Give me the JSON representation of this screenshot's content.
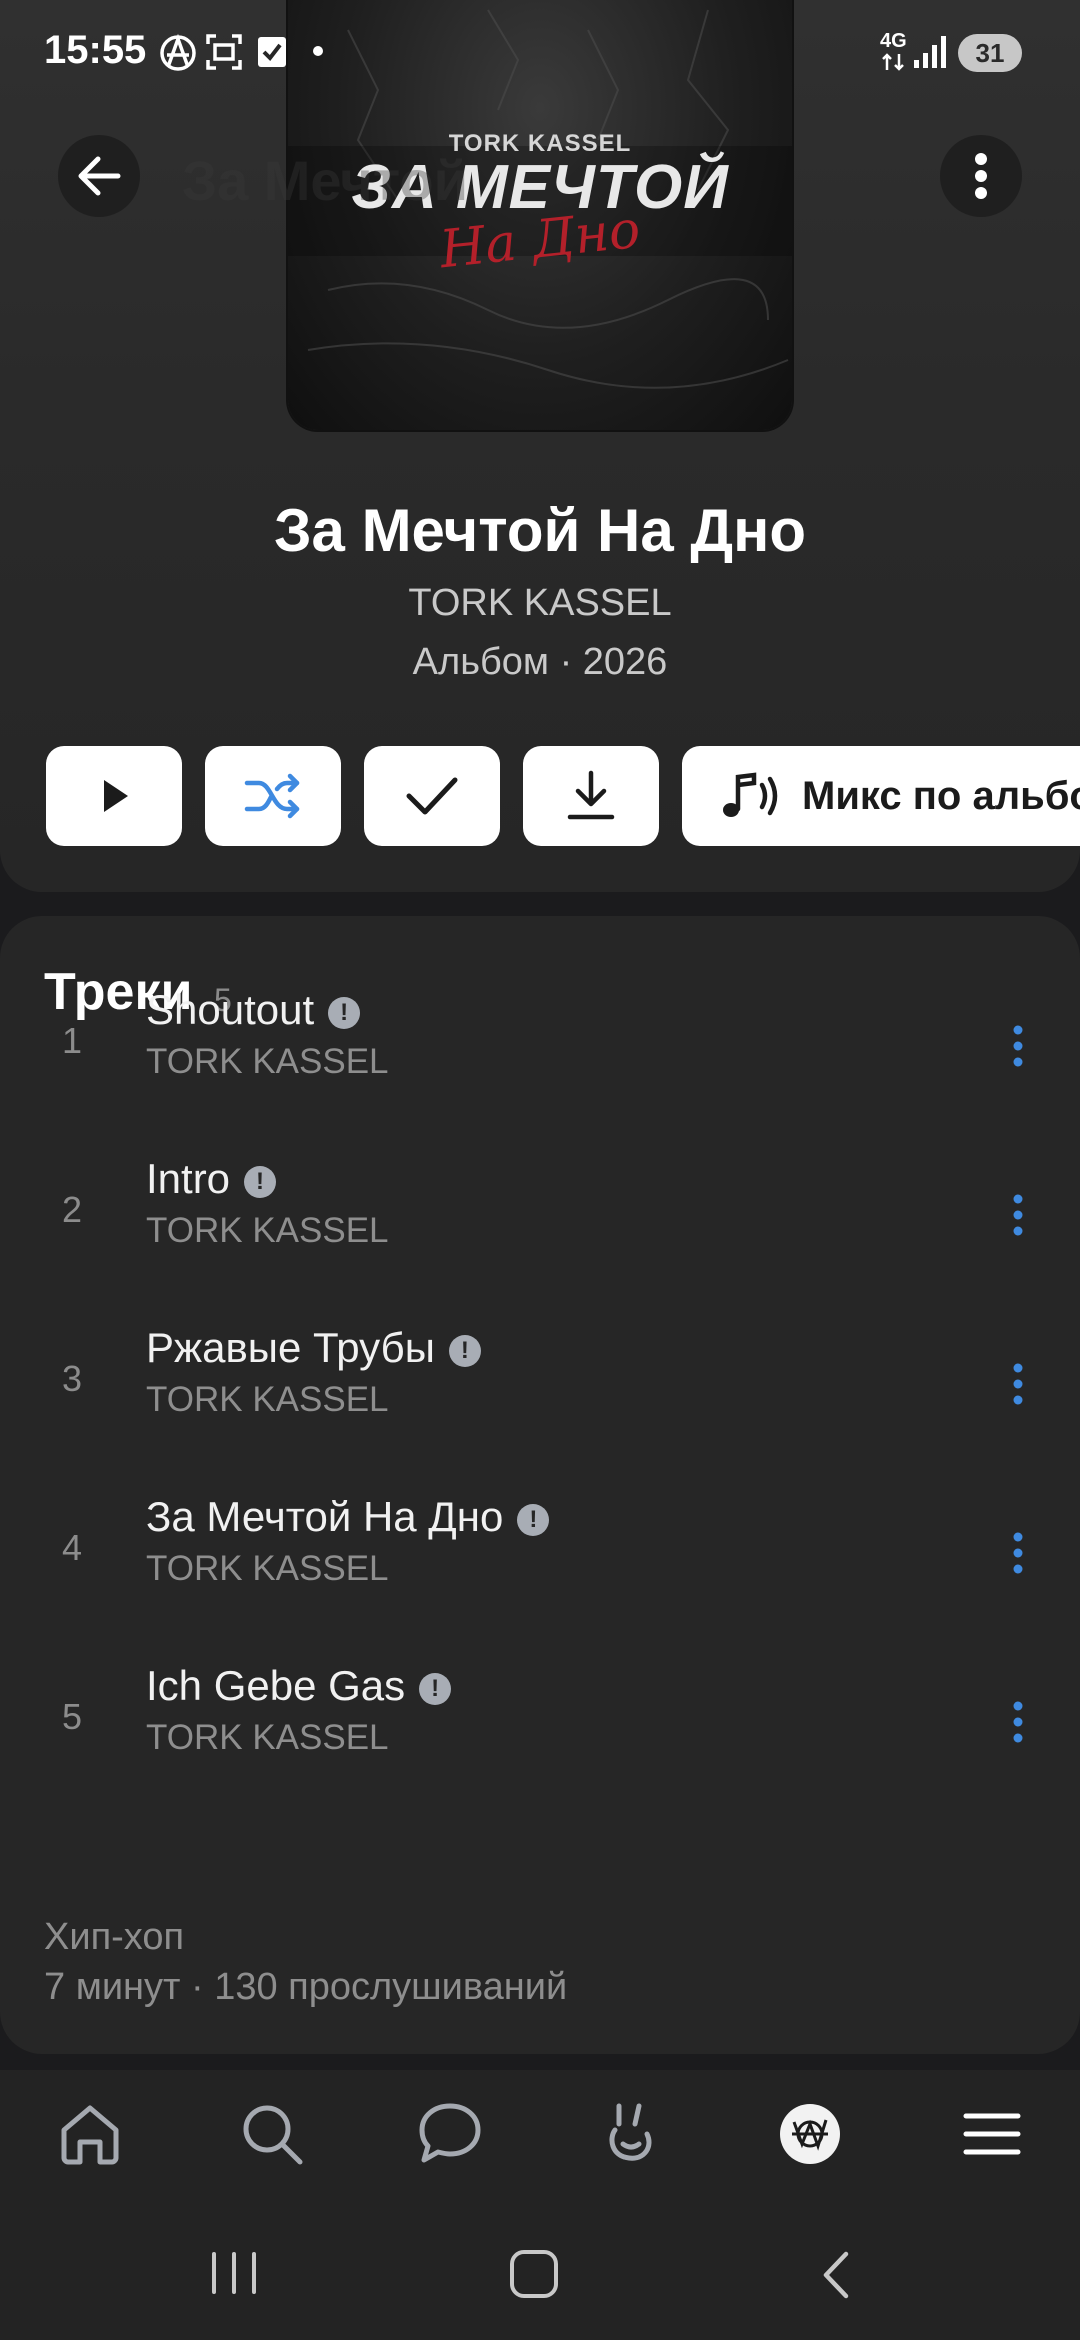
{
  "status_bar": {
    "time": "15:55",
    "network": "4G",
    "battery": "31"
  },
  "header": {
    "back_label": "back",
    "ghost_title": "За Мечтой"
  },
  "cover": {
    "artist_text": "TORK KASSEL",
    "title_line1": "ЗА МЕЧТОЙ",
    "title_line2": "На Дно"
  },
  "album": {
    "title": "За Мечтой На Дно",
    "artist": "TORK KASSEL",
    "meta": "Альбом · 2026"
  },
  "actions": {
    "mix_label": "Микс по альбому",
    "accent_color": "#3f8ae0"
  },
  "tracks": {
    "heading": "Треки",
    "count": "5",
    "items": [
      {
        "number": "1",
        "title": "Shoutout",
        "artist": "TORK KASSEL",
        "badge": "!"
      },
      {
        "number": "2",
        "title": "Intro",
        "artist": "TORK KASSEL",
        "badge": "!"
      },
      {
        "number": "3",
        "title": "Ржавые Трубы",
        "artist": "TORK KASSEL",
        "badge": "!"
      },
      {
        "number": "4",
        "title": "За Мечтой На Дно",
        "artist": "TORK KASSEL",
        "badge": "!"
      },
      {
        "number": "5",
        "title": "Ich Gebe Gas",
        "artist": "TORK KASSEL",
        "badge": "!"
      }
    ],
    "genre": "Хип-хоп",
    "stats": "7 минут · 130 прослушиваний"
  },
  "bottom_nav": {
    "items": [
      "home-icon",
      "search-icon",
      "messages-icon",
      "clips-icon",
      "profile-avatar",
      "menu-icon"
    ]
  }
}
